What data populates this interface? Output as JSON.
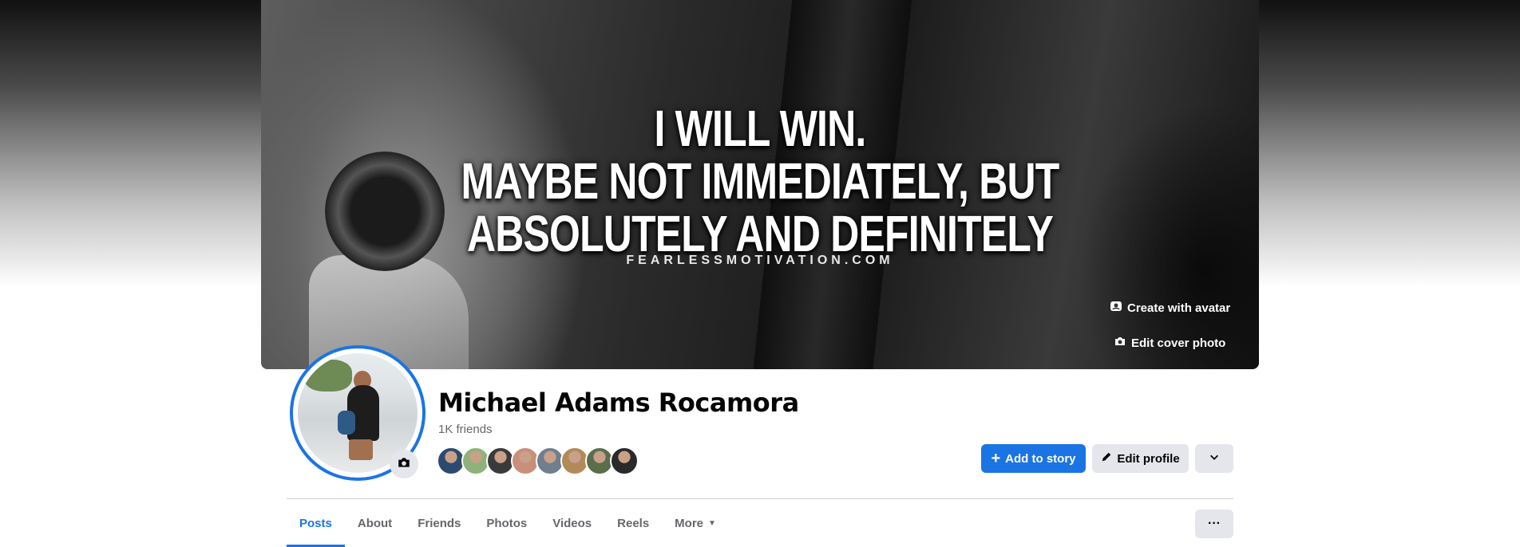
{
  "cover": {
    "quote_lines": [
      "I WILL WIN.",
      "MAYBE NOT IMMEDIATELY, BUT",
      "ABSOLUTELY AND DEFINITELY"
    ],
    "site": "FEARLESSMOTIVATION.COM",
    "create_avatar_label": "Create with avatar",
    "edit_cover_label": "Edit cover photo"
  },
  "profile": {
    "name": "Michael Adams Rocamora",
    "friends_count": "1K friends",
    "friend_avatar_colors": [
      "#2d4a6e",
      "#8fb27a",
      "#3a3a3a",
      "#c98f7a",
      "#6f7f8f",
      "#b28a5a",
      "#5a6e4a",
      "#2a2a2a"
    ]
  },
  "actions": {
    "add_story": "Add to story",
    "edit_profile": "Edit profile"
  },
  "tabs": [
    {
      "label": "Posts",
      "active": true
    },
    {
      "label": "About",
      "active": false
    },
    {
      "label": "Friends",
      "active": false
    },
    {
      "label": "Photos",
      "active": false
    },
    {
      "label": "Videos",
      "active": false
    },
    {
      "label": "Reels",
      "active": false
    },
    {
      "label": "More",
      "active": false
    }
  ],
  "colors": {
    "accent": "#1b74e4",
    "button_gray": "#e4e6eb",
    "text_secondary": "#65676b"
  }
}
